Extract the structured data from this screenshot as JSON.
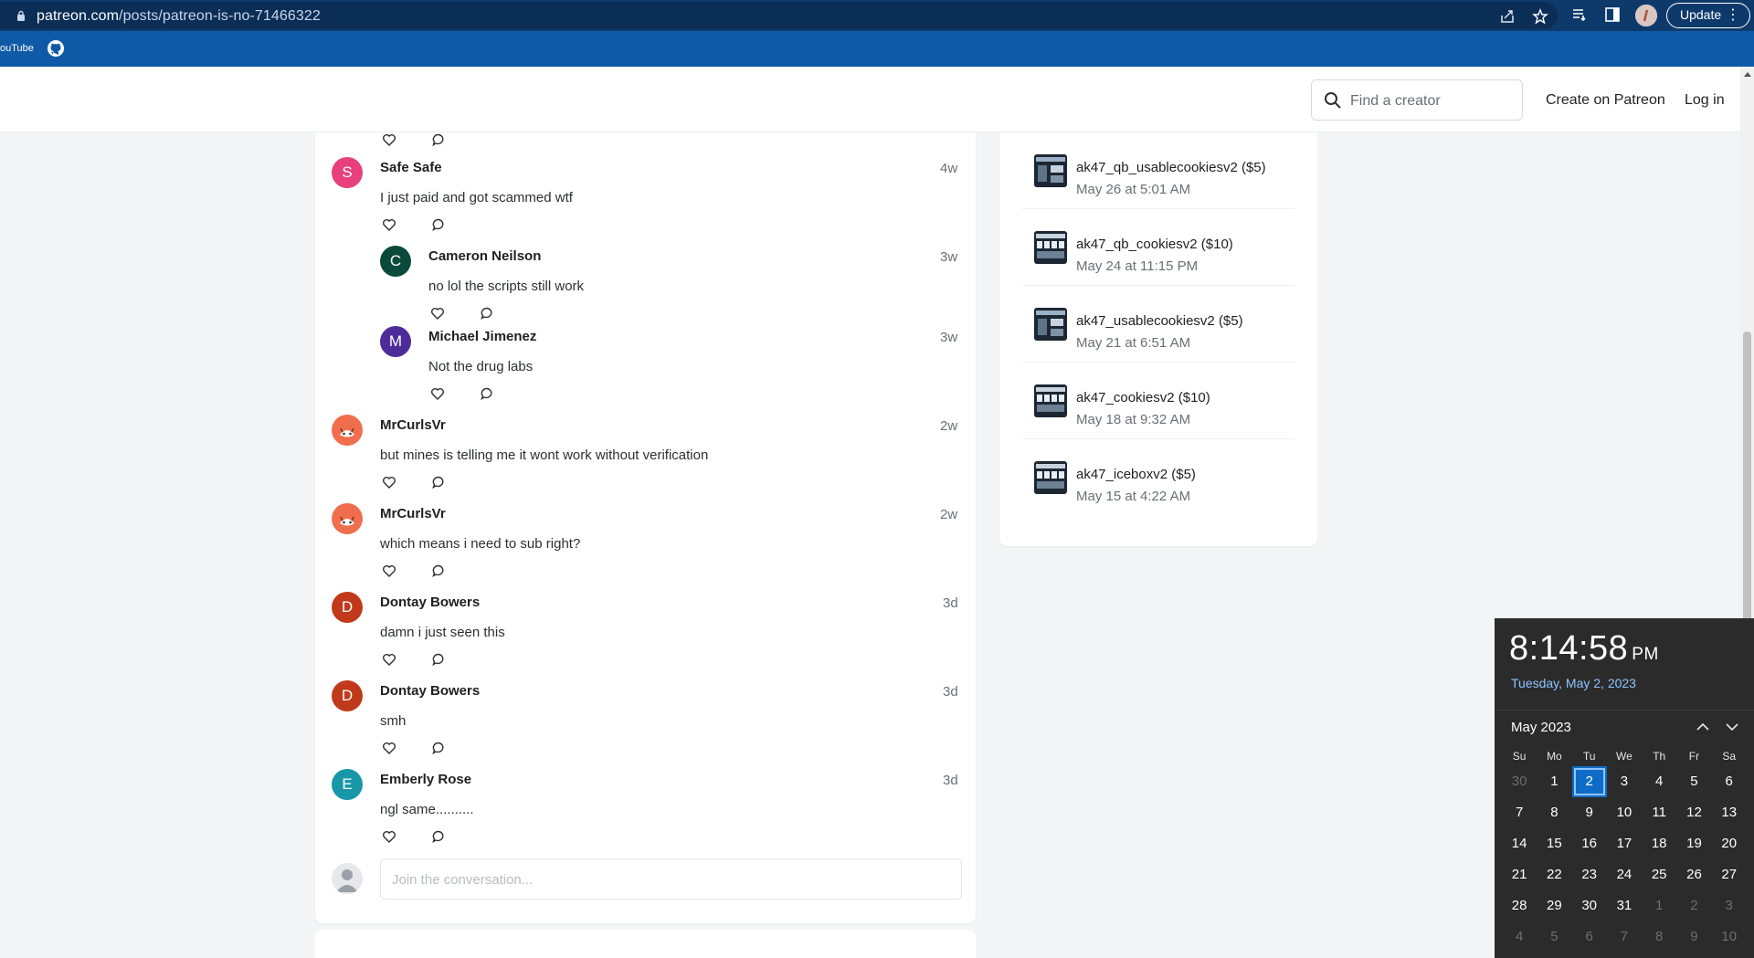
{
  "browser": {
    "url_host": "patreon.com",
    "url_path": "/posts/patreon-is-no-71466322",
    "update_label": "Update",
    "bookmarks": [
      {
        "label": "ouTube"
      },
      {
        "label": "",
        "icon": "github-icon"
      }
    ]
  },
  "header": {
    "search_placeholder": "Find a creator",
    "create_link": "Create on Patreon",
    "login_link": "Log in"
  },
  "comments": [
    {
      "name": "Safe Safe",
      "initial": "S",
      "color": "#e8407a",
      "time": "4w",
      "text": "I just paid and got scammed wtf"
    },
    {
      "name": "Cameron Neilson",
      "initial": "C",
      "color": "#0b4a3a",
      "time": "3w",
      "text": "no lol the scripts still work"
    },
    {
      "name": "Michael Jimenez",
      "initial": "M",
      "color": "#4d2c9a",
      "time": "3w",
      "text": "Not the drug labs"
    },
    {
      "name": "MrCurlsVr",
      "initial": "",
      "color": "#f06e4e",
      "time": "2w",
      "text": "but mines is telling me it wont work without verification"
    },
    {
      "name": "MrCurlsVr",
      "initial": "",
      "color": "#f06e4e",
      "time": "2w",
      "text": "which means i need to sub right?"
    },
    {
      "name": "Dontay Bowers",
      "initial": "D",
      "color": "#c0391a",
      "time": "3d",
      "text": "damn i just seen this"
    },
    {
      "name": "Dontay Bowers",
      "initial": "D",
      "color": "#c0391a",
      "time": "3d",
      "text": "smh"
    },
    {
      "name": "Emberly Rose",
      "initial": "E",
      "color": "#1797a8",
      "time": "3d",
      "text": "ngl same.........."
    }
  ],
  "join_placeholder": "Join the conversation...",
  "posts": [
    {
      "title": "ak47_qb_usablecookiesv2 ($5)",
      "date": "May 26 at 5:01 AM"
    },
    {
      "title": "ak47_qb_cookiesv2 ($10)",
      "date": "May 24 at 11:15 PM"
    },
    {
      "title": "ak47_usablecookiesv2 ($5)",
      "date": "May 21 at 6:51 AM"
    },
    {
      "title": "ak47_cookiesv2 ($10)",
      "date": "May 18 at 9:32 AM"
    },
    {
      "title": "ak47_iceboxv2 ($5)",
      "date": "May 15 at 4:22 AM"
    }
  ],
  "clock": {
    "time": "8:14:58",
    "ampm": "PM",
    "date": "Tuesday, May 2, 2023",
    "month_label": "May 2023",
    "weekdays": [
      "Su",
      "Mo",
      "Tu",
      "We",
      "Th",
      "Fr",
      "Sa"
    ],
    "weeks": [
      [
        "30",
        "1",
        "2",
        "3",
        "4",
        "5",
        "6"
      ],
      [
        "7",
        "8",
        "9",
        "10",
        "11",
        "12",
        "13"
      ],
      [
        "14",
        "15",
        "16",
        "17",
        "18",
        "19",
        "20"
      ],
      [
        "21",
        "22",
        "23",
        "24",
        "25",
        "26",
        "27"
      ],
      [
        "28",
        "29",
        "30",
        "31",
        "1",
        "2",
        "3"
      ],
      [
        "4",
        "5",
        "6",
        "7",
        "8",
        "9",
        "10"
      ]
    ],
    "today": "2"
  },
  "colors": {
    "chrome_bar": "#0e3a6b",
    "bookmarks_bar": "#0f5aa6",
    "clock_bg": "#2b2b2b",
    "today_blue": "#0f6cc6"
  }
}
